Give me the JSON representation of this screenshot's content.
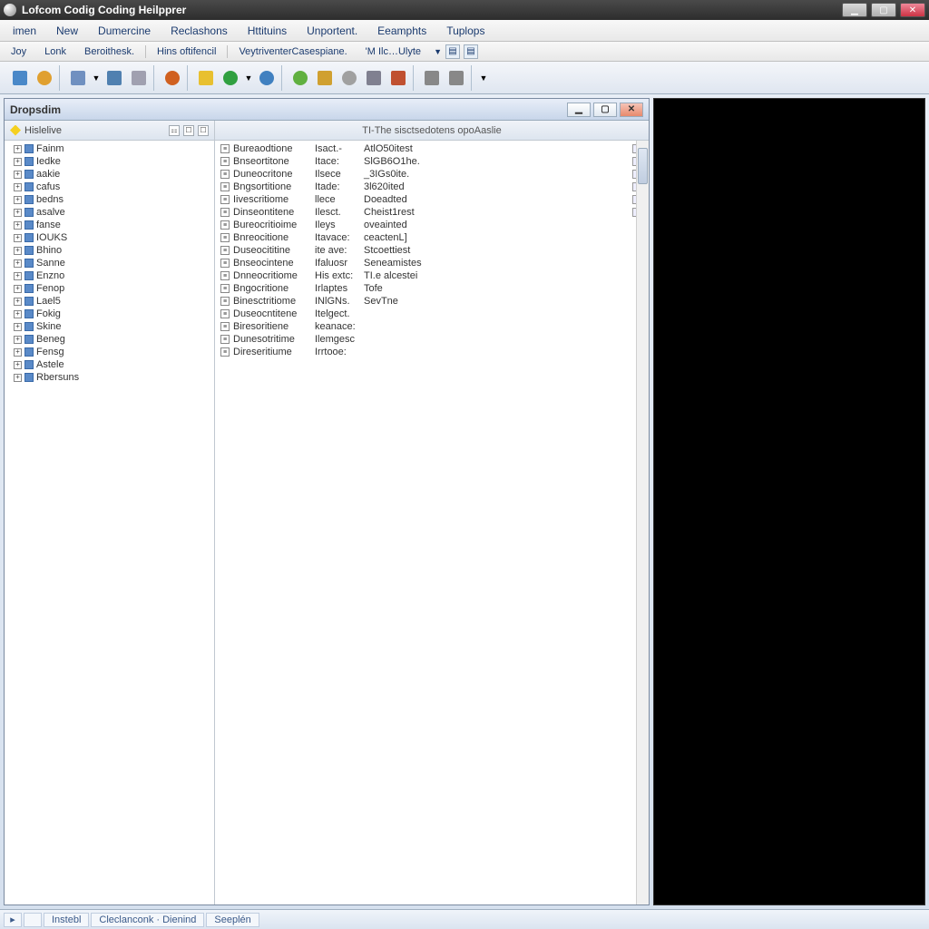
{
  "titlebar": {
    "title": "Lofcom Codig Coding Heilpprer"
  },
  "menubar": {
    "items": [
      "imen",
      "New",
      "Dumercine",
      "Reclashons",
      "Httituins",
      "Unportent.",
      "Eeamphts",
      "Tuplops"
    ]
  },
  "linkbar": {
    "items": [
      "Joy",
      "Lonk",
      "Beroithesk.",
      "Hins oftifencil",
      "VeytriventerCasespiane.",
      "'M Ilc…Ulyte"
    ]
  },
  "toolbar": {
    "groups": [
      {
        "icons": [
          {
            "name": "doc-icon",
            "color": "#4a88c8"
          },
          {
            "name": "globe-icon",
            "color": "#e0a030"
          }
        ]
      },
      {
        "icons": [
          {
            "name": "page-icon",
            "color": "#7090c0"
          },
          {
            "name": "dd-arrow-icon",
            "color": "#888"
          },
          {
            "name": "calc-icon",
            "color": "#5080b0"
          },
          {
            "name": "pen-icon",
            "color": "#a0a0b0"
          }
        ]
      },
      {
        "icons": [
          {
            "name": "circle-icon",
            "color": "#d06020"
          }
        ]
      },
      {
        "icons": [
          {
            "name": "yellow-box-icon",
            "color": "#e8c030"
          },
          {
            "name": "green-circle-icon",
            "color": "#30a040"
          },
          {
            "name": "dd-arrow-icon",
            "color": "#888"
          },
          {
            "name": "blue-circle-icon",
            "color": "#4080c0"
          }
        ]
      },
      {
        "icons": [
          {
            "name": "green-ball-icon",
            "color": "#60b040"
          },
          {
            "name": "folder-icon",
            "color": "#d0a030"
          },
          {
            "name": "gray-ball-icon",
            "color": "#a0a0a0"
          },
          {
            "name": "tool-icon",
            "color": "#808090"
          },
          {
            "name": "chart-icon",
            "color": "#c05030"
          }
        ]
      },
      {
        "icons": [
          {
            "name": "vbar1-icon",
            "color": "#888"
          },
          {
            "name": "vbar2-icon",
            "color": "#888"
          }
        ]
      },
      {
        "icons": [
          {
            "name": "dd-arrow-icon",
            "color": "#888"
          }
        ]
      }
    ]
  },
  "childwin": {
    "title": "Dropsdim",
    "tree_header": "Hislelive",
    "tree_items": [
      "Fainm",
      "Iedke",
      "aakie",
      "cafus",
      "bedns",
      "asalve",
      "fanse",
      "IOUKS",
      "Bhino",
      "Sanne",
      "Enzno",
      "Fenop",
      "Lael5",
      "Fokig",
      "Skine",
      "Beneg",
      "Fensg",
      "Astele",
      "Rbersuns"
    ],
    "list_header": "TI-The sisctsedotens opoAaslie",
    "list_rows": [
      {
        "c1": "Bureaodtione",
        "c2": "Isact.-",
        "c3": "AtlO50itest",
        "tail": true
      },
      {
        "c1": "Bnseortitone",
        "c2": "Itace:",
        "c3": "SlGB6O1he.",
        "tail": true
      },
      {
        "c1": "Duneocritone",
        "c2": "Ilsece",
        "c3": "_3IGs0ite.",
        "tail": true
      },
      {
        "c1": "Bngsortitione",
        "c2": "Itade:",
        "c3": "3l620ited",
        "tail": true
      },
      {
        "c1": "Iivescritiome",
        "c2": "llece",
        "c3": "Doeadted",
        "tail": true
      },
      {
        "c1": "Dinseontitene",
        "c2": "Ilesct.",
        "c3": "Cheist1rest",
        "tail": true
      },
      {
        "c1": "Bureocritioime",
        "c2": "Ileys",
        "c3": "oveainted",
        "tail": false
      },
      {
        "c1": "Bnreocitione",
        "c2": "Itavace:",
        "c3": "ceactenL]",
        "tail": false
      },
      {
        "c1": "Duseocititine",
        "c2": "ite ave:",
        "c3": "Stcoettiest",
        "tail": false
      },
      {
        "c1": "Bnseocintene",
        "c2": "Ifaluosr",
        "c3": "Seneamistes",
        "tail": false
      },
      {
        "c1": "Dnneocritiome",
        "c2": "His extc:",
        "c3": "TI.e alcestei",
        "tail": false
      },
      {
        "c1": "Bngocritione",
        "c2": "Irlaptes",
        "c3": "Tofe",
        "tail": false
      },
      {
        "c1": "Binesctritiome",
        "c2": "INlGNs.",
        "c3": "SevTne",
        "tail": false
      },
      {
        "c1": "Duseocntitene",
        "c2": "Itelgect.",
        "c3": "",
        "tail": false
      },
      {
        "c1": "Biresoritiene",
        "c2": "keanace:",
        "c3": "",
        "tail": false
      },
      {
        "c1": "Dunesotritime",
        "c2": "Ilemgesc",
        "c3": "",
        "tail": false
      },
      {
        "c1": "Direseritiume",
        "c2": "Irrtooe:",
        "c3": "",
        "tail": false
      }
    ]
  },
  "statusbar": {
    "cells": [
      "Instebl",
      "Cleclanconk · Dienind",
      "Seeplén"
    ]
  }
}
